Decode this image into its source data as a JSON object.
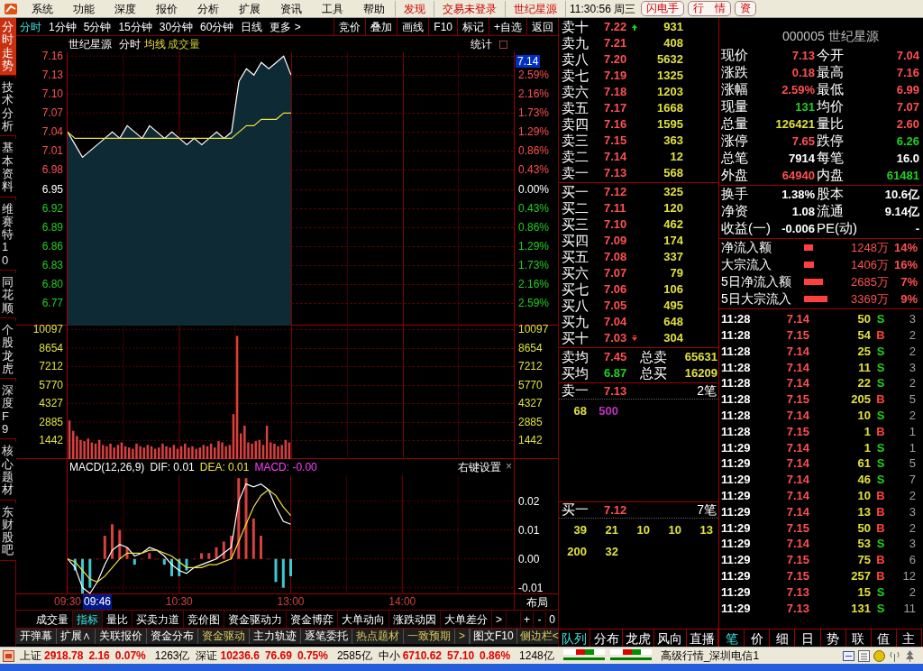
{
  "menu_bar": {
    "items": [
      "系统",
      "功能",
      "深度",
      "报价",
      "分析",
      "扩展",
      "资讯",
      "工具",
      "帮助"
    ],
    "links": [
      {
        "label": "发现"
      },
      {
        "label": "交易未登录"
      },
      {
        "label": "世纪星源"
      }
    ],
    "clock": "11:30:56 周三",
    "buttons": [
      "闪电手",
      "行　情",
      "资"
    ]
  },
  "side_tabs": [
    {
      "label": "分时走势",
      "selected": true
    },
    {
      "label": "技术分析",
      "selected": false
    },
    {
      "label": "基本资料",
      "selected": false
    },
    {
      "label": "维赛特10",
      "selected": false
    },
    {
      "label": "同花顺",
      "selected": false
    },
    {
      "label": "个股龙虎",
      "selected": false
    },
    {
      "label": "深度F9",
      "selected": false
    },
    {
      "label": "核心题材",
      "selected": false
    },
    {
      "label": "东财股吧",
      "selected": false
    }
  ],
  "period_tabs": [
    {
      "label": "分时",
      "selected": true
    },
    {
      "label": "1分钟",
      "selected": false
    },
    {
      "label": "5分钟",
      "selected": false
    },
    {
      "label": "15分钟",
      "selected": false
    },
    {
      "label": "30分钟",
      "selected": false
    },
    {
      "label": "60分钟",
      "selected": false
    },
    {
      "label": "日线",
      "selected": false
    },
    {
      "label": "更多 >",
      "selected": false
    }
  ],
  "chart_tools": [
    "竞价",
    "叠加",
    "画线",
    "F10",
    "标记",
    "+自选",
    "返回"
  ],
  "chart_header": {
    "name": "世纪星源",
    "mode": "分时",
    "stats": "统计"
  },
  "price_chart": {
    "current_price": "7.14",
    "pct_ticks": [
      "2.59%",
      "2.16%",
      "1.73%",
      "1.29%",
      "0.86%",
      "0.43%",
      "0.00%",
      "0.43%",
      "0.86%",
      "1.29%",
      "1.73%",
      "2.16%",
      "2.59%"
    ],
    "chart_data": {
      "type": "area",
      "grid": true,
      "ylim": [
        6.734,
        7.166
      ],
      "categories": [
        null,
        null,
        null,
        null,
        null,
        null,
        null,
        null,
        null,
        null,
        null,
        null,
        null,
        null,
        null,
        null,
        null,
        null,
        null,
        null,
        null,
        null,
        null,
        null,
        null,
        null,
        null,
        null,
        null,
        null,
        null
      ],
      "series": [
        {
          "color": "#ffffff",
          "values": [
            7.04,
            7.02,
            7.0,
            7.01,
            7.02,
            7.03,
            7.04,
            7.03,
            7.05,
            7.04,
            7.03,
            7.05,
            7.04,
            7.03,
            7.04,
            7.03,
            7.02,
            7.03,
            7.02,
            7.03,
            7.04,
            7.03,
            7.04,
            7.12,
            7.14,
            7.13,
            7.15,
            7.14,
            7.15,
            7.16,
            7.13
          ]
        },
        {
          "name": "均线",
          "type": "line",
          "color": "#f0e040",
          "values": [
            7.04,
            7.03,
            7.03,
            7.03,
            7.03,
            7.03,
            7.03,
            7.03,
            7.03,
            7.03,
            7.03,
            7.03,
            7.03,
            7.03,
            7.03,
            7.03,
            7.03,
            7.03,
            7.03,
            7.03,
            7.03,
            7.03,
            7.03,
            7.04,
            7.05,
            7.05,
            7.06,
            7.06,
            7.06,
            7.07,
            7.07
          ]
        }
      ],
      "yticks": [
        {
          "value": 7.16,
          "label": "7.16"
        },
        {
          "value": 7.13,
          "label": "7.13"
        },
        {
          "value": 7.1,
          "label": "7.10"
        },
        {
          "value": 7.07,
          "label": "7.07"
        },
        {
          "value": 7.04,
          "label": "7.04"
        },
        {
          "value": 7.01,
          "label": "7.01"
        },
        {
          "value": 6.98,
          "label": "6.98"
        },
        {
          "value": 6.95,
          "label": "6.95"
        },
        {
          "value": 6.92,
          "label": "6.92"
        },
        {
          "value": 6.89,
          "label": "6.89"
        },
        {
          "value": 6.86,
          "label": "6.86"
        },
        {
          "value": 6.83,
          "label": "6.83"
        },
        {
          "value": 6.8,
          "label": "6.80"
        },
        {
          "value": 6.77,
          "label": "6.77"
        }
      ]
    }
  },
  "volume_chart": {
    "chart_data": {
      "type": "bar",
      "grid": true,
      "ylim": [
        0,
        10400
      ],
      "categories": [
        null,
        null,
        null,
        null,
        null,
        null,
        null,
        null,
        null,
        null,
        null,
        null,
        null,
        null,
        null,
        null,
        null,
        null,
        null,
        null,
        null,
        null,
        null,
        null,
        null,
        null,
        null,
        null,
        null,
        null,
        null,
        null,
        null,
        null,
        null,
        null,
        null,
        null,
        null,
        null,
        null,
        null,
        null,
        null,
        null,
        null,
        null,
        null,
        null,
        null,
        null,
        null,
        null,
        null,
        null,
        null,
        null,
        null,
        null,
        null
      ],
      "series": [
        {
          "name": "成交量",
          "color": "#d84040",
          "values": [
            3000,
            2200,
            1800,
            1500,
            1400,
            1600,
            1300,
            1200,
            1500,
            1100,
            1000,
            1200,
            900,
            1100,
            1300,
            1000,
            900,
            800,
            1200,
            1000,
            900,
            1100,
            1000,
            800,
            900,
            1200,
            1000,
            900,
            1100,
            800,
            1000,
            1200,
            900,
            1000,
            800,
            900,
            1100,
            1000,
            1200,
            900,
            1400,
            1300,
            1000,
            1100,
            3500,
            9600,
            2000,
            2600,
            1300,
            1200,
            1400,
            1500,
            1100,
            2600,
            1300,
            1200,
            1000,
            1100,
            1500,
            1300
          ]
        }
      ],
      "yticks": [
        {
          "value": 10097,
          "label": "10097"
        },
        {
          "value": 8654,
          "label": "8654"
        },
        {
          "value": 7212,
          "label": "7212"
        },
        {
          "value": 5770,
          "label": "5770"
        },
        {
          "value": 4327,
          "label": "4327"
        },
        {
          "value": 2885,
          "label": "2885"
        },
        {
          "value": 1442,
          "label": "1442"
        }
      ]
    }
  },
  "macd_chart": {
    "legend": [
      {
        "text": "MACD(12,26,9)",
        "color": "#ffffff"
      },
      {
        "text": "DIF: 0.01",
        "color": "#ffffff"
      },
      {
        "text": "DEA: 0.01",
        "color": "#f0e040"
      },
      {
        "text": "MACD: -0.00",
        "color": "#ff40ff"
      }
    ],
    "settings": "右键设置",
    "close": "×",
    "chart_data": {
      "type": "line",
      "grid": true,
      "ylim": [
        -0.0123,
        0.029
      ],
      "categories": [
        "09:30",
        null,
        null,
        null,
        null,
        null,
        null,
        null,
        null,
        null,
        null,
        null,
        null,
        null,
        null,
        "10:30",
        null,
        null,
        null,
        null,
        null,
        null,
        null,
        null,
        null,
        null,
        null,
        null,
        null,
        null,
        "13:00",
        null,
        null,
        null,
        null,
        null,
        null,
        null,
        null,
        null,
        null,
        null,
        null,
        null,
        null,
        "14:00",
        null,
        null,
        null,
        null,
        null,
        null,
        null,
        null,
        null,
        null,
        null,
        null,
        null,
        null,
        null
      ],
      "series": [
        {
          "type": "bar",
          "color": "#d84040",
          "values": [
            0,
            null,
            null,
            null,
            0,
            0.008,
            0.012,
            0.01,
            0.004,
            null,
            0,
            0.002,
            0,
            null,
            null,
            null,
            null,
            0,
            0.002,
            0.002,
            0.004,
            0.006,
            0.008,
            0.028,
            0.028,
            0.014,
            0.008,
            0,
            null,
            null,
            null,
            null,
            null,
            null,
            null,
            null,
            null,
            null,
            null,
            null,
            null,
            null,
            null,
            null,
            null,
            null,
            null,
            null,
            null,
            null,
            null,
            null,
            null,
            null,
            null,
            null,
            null,
            null,
            null,
            null,
            null
          ]
        },
        {
          "type": "bar",
          "color": "#40c8d0",
          "values": [
            null,
            -0.004,
            -0.012,
            -0.01,
            null,
            null,
            null,
            null,
            null,
            -0.002,
            null,
            null,
            null,
            -0.002,
            -0.006,
            -0.006,
            -0.004,
            null,
            null,
            null,
            null,
            null,
            null,
            null,
            null,
            null,
            null,
            null,
            -0.008,
            -0.01,
            -0.006,
            null,
            null,
            null,
            null,
            null,
            null,
            null,
            null,
            null,
            null,
            null,
            null,
            null,
            null,
            null,
            null,
            null,
            null,
            null,
            null,
            null,
            null,
            null,
            null,
            null,
            null,
            null,
            null,
            null,
            null
          ]
        },
        {
          "type": "line",
          "color": "#ffffff",
          "values": [
            0,
            -0.003,
            -0.01,
            -0.012,
            -0.008,
            -0.002,
            0.003,
            0.005,
            0.004,
            0.001,
            0.002,
            0.004,
            0.003,
            0.001,
            -0.002,
            -0.004,
            -0.005,
            -0.003,
            -0.002,
            -0.001,
            0,
            0.002,
            0.004,
            0.02,
            0.026,
            0.025,
            0.026,
            0.024,
            0.018,
            0.013,
            0.012,
            null,
            null,
            null,
            null,
            null,
            null,
            null,
            null,
            null,
            null,
            null,
            null,
            null,
            null,
            null,
            null,
            null,
            null,
            null,
            null,
            null,
            null,
            null,
            null,
            null,
            null,
            null,
            null,
            null,
            null
          ]
        },
        {
          "type": "line",
          "color": "#f0e040",
          "values": [
            0,
            -0.001,
            -0.004,
            -0.007,
            -0.008,
            -0.006,
            -0.003,
            0,
            0.002,
            0.002,
            0.002,
            0.003,
            0.003,
            0.002,
            0.001,
            -0.001,
            -0.003,
            -0.003,
            -0.003,
            -0.002,
            -0.002,
            -0.001,
            0,
            0.006,
            0.012,
            0.018,
            0.022,
            0.024,
            0.022,
            0.018,
            0.015,
            null,
            null,
            null,
            null,
            null,
            null,
            null,
            null,
            null,
            null,
            null,
            null,
            null,
            null,
            null,
            null,
            null,
            null,
            null,
            null,
            null,
            null,
            null,
            null,
            null,
            null,
            null,
            null,
            null,
            null
          ]
        }
      ],
      "yticks": [
        {
          "value": 0.02,
          "label": "0.02"
        },
        {
          "value": 0.01,
          "label": "0.01"
        },
        {
          "value": 0,
          "label": "0.00"
        },
        {
          "value": -0.01,
          "label": "-0.01"
        }
      ]
    }
  },
  "time_axis": {
    "cursor": "09:46",
    "layout_button": "布局"
  },
  "indicator_tabs": [
    {
      "label": "成交量",
      "selected": false
    },
    {
      "label": "指标",
      "selected": true
    },
    {
      "label": "量比",
      "selected": false
    },
    {
      "label": "买卖力道",
      "selected": false
    },
    {
      "label": "竞价图",
      "selected": false
    },
    {
      "label": "资金驱动力",
      "selected": false
    },
    {
      "label": "资金博弈",
      "selected": false
    },
    {
      "label": "大单动向",
      "selected": false
    },
    {
      "label": "涨跌动因",
      "selected": false
    },
    {
      "label": "大单差分",
      "selected": false
    },
    {
      "label": ">",
      "selected": false
    }
  ],
  "zoom_buttons": [
    "+",
    "-",
    "0"
  ],
  "feature_tabs": [
    {
      "label": "开弹幕",
      "highlighted": false
    },
    {
      "label": "扩展∧",
      "highlighted": false
    },
    {
      "label": "关联报价",
      "highlighted": false
    },
    {
      "label": "资金分布",
      "highlighted": false
    },
    {
      "label": "资金驱动",
      "highlighted": true
    },
    {
      "label": "主力轨迹",
      "highlighted": false
    },
    {
      "label": "逐笔委托",
      "highlighted": false
    },
    {
      "label": "热点题材",
      "highlighted": true
    },
    {
      "label": "一致预期",
      "highlighted": true
    },
    {
      "label": ">",
      "highlighted": true
    }
  ],
  "feature_right": [
    {
      "label": "图文F10",
      "highlighted": false
    },
    {
      "label": "侧边栏<",
      "highlighted": true
    }
  ],
  "order_book": {
    "asks": [
      {
        "label": "卖十",
        "price": "7.22",
        "volume": "931",
        "marker": true
      },
      {
        "label": "卖九",
        "price": "7.21",
        "volume": "408",
        "marker": false
      },
      {
        "label": "卖八",
        "price": "7.20",
        "volume": "5632",
        "marker": false
      },
      {
        "label": "卖七",
        "price": "7.19",
        "volume": "1325",
        "marker": false
      },
      {
        "label": "卖六",
        "price": "7.18",
        "volume": "1203",
        "marker": false
      },
      {
        "label": "卖五",
        "price": "7.17",
        "volume": "1668",
        "marker": false
      },
      {
        "label": "卖四",
        "price": "7.16",
        "volume": "1595",
        "marker": false
      },
      {
        "label": "卖三",
        "price": "7.15",
        "volume": "363",
        "marker": false
      },
      {
        "label": "卖二",
        "price": "7.14",
        "volume": "12",
        "marker": false
      },
      {
        "label": "卖一",
        "price": "7.13",
        "volume": "568",
        "marker": false
      }
    ],
    "bids": [
      {
        "label": "买一",
        "price": "7.12",
        "volume": "325",
        "marker": false
      },
      {
        "label": "买二",
        "price": "7.11",
        "volume": "120",
        "marker": false
      },
      {
        "label": "买三",
        "price": "7.10",
        "volume": "462",
        "marker": false
      },
      {
        "label": "买四",
        "price": "7.09",
        "volume": "174",
        "marker": false
      },
      {
        "label": "买五",
        "price": "7.08",
        "volume": "337",
        "marker": false
      },
      {
        "label": "买六",
        "price": "7.07",
        "volume": "79",
        "marker": false
      },
      {
        "label": "买七",
        "price": "7.06",
        "volume": "106",
        "marker": false
      },
      {
        "label": "买八",
        "price": "7.05",
        "volume": "495",
        "marker": false
      },
      {
        "label": "买九",
        "price": "7.04",
        "volume": "648",
        "marker": false
      },
      {
        "label": "买十",
        "price": "7.03",
        "volume": "304",
        "marker": true
      }
    ],
    "averages": [
      {
        "label": "卖均",
        "price": "7.45",
        "color": "#ff5050",
        "total_label": "总卖",
        "total": "65631"
      },
      {
        "label": "买均",
        "price": "6.87",
        "color": "#20d020",
        "total_label": "总买",
        "total": "16209"
      }
    ],
    "queues": [
      {
        "label": "卖一",
        "price": "7.13",
        "count": "2笔",
        "orders": [
          {
            "text": "68",
            "color": "#e0e040"
          },
          {
            "text": "500",
            "color": "#c030c0"
          }
        ]
      },
      {
        "label": "买一",
        "price": "7.12",
        "count": "7笔",
        "orders": [
          {
            "text": "39",
            "color": "#e0e040"
          },
          {
            "text": "21",
            "color": "#e0e040"
          },
          {
            "text": "10",
            "color": "#e0e040"
          },
          {
            "text": "10",
            "color": "#e0e040"
          },
          {
            "text": "13",
            "color": "#e0e040"
          },
          {
            "text": "200",
            "color": "#e0e040"
          },
          {
            "text": "32",
            "color": "#e0e040"
          }
        ]
      }
    ],
    "tabs": [
      {
        "label": "队列",
        "selected": true
      },
      {
        "label": "分布",
        "selected": false
      },
      {
        "label": "龙虎",
        "selected": false
      },
      {
        "label": "风向",
        "selected": false
      },
      {
        "label": "直播",
        "selected": false
      }
    ]
  },
  "quote": {
    "title": "000005 世纪星源",
    "rows": [
      [
        {
          "label": "现价",
          "value": "7.13",
          "color": "#ff5050"
        },
        {
          "label": "今开",
          "value": "7.04",
          "color": "#ff5050"
        }
      ],
      [
        {
          "label": "涨跌",
          "value": "0.18",
          "color": "#ff5050"
        },
        {
          "label": "最高",
          "value": "7.16",
          "color": "#ff5050"
        }
      ],
      [
        {
          "label": "涨幅",
          "value": "2.59%",
          "color": "#ff5050"
        },
        {
          "label": "最低",
          "value": "6.99",
          "color": "#ff5050"
        }
      ],
      [
        {
          "label": "现量",
          "value": "131",
          "color": "#20d020"
        },
        {
          "label": "均价",
          "value": "7.07",
          "color": "#ff5050"
        }
      ],
      [
        {
          "label": "总量",
          "value": "126421",
          "color": "#e0e040"
        },
        {
          "label": "量比",
          "value": "2.60",
          "color": "#ff5050"
        }
      ],
      [
        {
          "label": "涨停",
          "value": "7.65",
          "color": "#ff5050"
        },
        {
          "label": "跌停",
          "value": "6.26",
          "color": "#20d020"
        }
      ],
      [
        {
          "label": "总笔",
          "value": "7914",
          "color": "#ffffff"
        },
        {
          "label": "每笔",
          "value": "16.0",
          "color": "#ffffff"
        }
      ],
      [
        {
          "label": "外盘",
          "value": "64940",
          "color": "#ff5050"
        },
        {
          "label": "内盘",
          "value": "61481",
          "color": "#20d020"
        }
      ]
    ],
    "fundamentals": [
      [
        {
          "label": "换手",
          "value": "1.38%"
        },
        {
          "label": "股本",
          "value": "10.6亿"
        }
      ],
      [
        {
          "label": "净资",
          "value": "1.08"
        },
        {
          "label": "流通",
          "value": "9.14亿"
        }
      ],
      [
        {
          "label": "收益(一)",
          "value": "-0.006"
        },
        {
          "label": "PE(动)",
          "value": "-"
        }
      ]
    ],
    "flows": [
      {
        "label": "净流入额",
        "amount": "1248万",
        "pct": "14%"
      },
      {
        "label": "大宗流入",
        "amount": "1406万",
        "pct": "16%"
      },
      {
        "label": "5日净流入额",
        "amount": "2685万",
        "pct": "7%"
      },
      {
        "label": "5日大宗流入",
        "amount": "3369万",
        "pct": "9%"
      }
    ]
  },
  "trades": [
    {
      "time": "11:28",
      "price": "7.14",
      "volume": "50",
      "side": "S",
      "color": "#20d020",
      "count": "3"
    },
    {
      "time": "11:28",
      "price": "7.15",
      "volume": "54",
      "side": "B",
      "color": "#ff4040",
      "count": "2"
    },
    {
      "time": "11:28",
      "price": "7.14",
      "volume": "25",
      "side": "S",
      "color": "#20d020",
      "count": "2"
    },
    {
      "time": "11:28",
      "price": "7.14",
      "volume": "11",
      "side": "S",
      "color": "#20d020",
      "count": "3"
    },
    {
      "time": "11:28",
      "price": "7.14",
      "volume": "22",
      "side": "S",
      "color": "#20d020",
      "count": "2"
    },
    {
      "time": "11:28",
      "price": "7.15",
      "volume": "205",
      "side": "B",
      "color": "#ff4040",
      "count": "5"
    },
    {
      "time": "11:28",
      "price": "7.14",
      "volume": "10",
      "side": "S",
      "color": "#20d020",
      "count": "2"
    },
    {
      "time": "11:28",
      "price": "7.15",
      "volume": "1",
      "side": "B",
      "color": "#ff4040",
      "count": "1"
    },
    {
      "time": "11:29",
      "price": "7.14",
      "volume": "1",
      "side": "S",
      "color": "#20d020",
      "count": "1"
    },
    {
      "time": "11:29",
      "price": "7.14",
      "volume": "61",
      "side": "S",
      "color": "#20d020",
      "count": "5"
    },
    {
      "time": "11:29",
      "price": "7.14",
      "volume": "46",
      "side": "S",
      "color": "#20d020",
      "count": "7"
    },
    {
      "time": "11:29",
      "price": "7.14",
      "volume": "10",
      "side": "B",
      "color": "#ff4040",
      "count": "2"
    },
    {
      "time": "11:29",
      "price": "7.14",
      "volume": "13",
      "side": "B",
      "color": "#ff4040",
      "count": "3"
    },
    {
      "time": "11:29",
      "price": "7.15",
      "volume": "50",
      "side": "B",
      "color": "#ff4040",
      "count": "2"
    },
    {
      "time": "11:29",
      "price": "7.14",
      "volume": "53",
      "side": "S",
      "color": "#20d020",
      "count": "3"
    },
    {
      "time": "11:29",
      "price": "7.15",
      "volume": "75",
      "side": "B",
      "color": "#ff4040",
      "count": "6"
    },
    {
      "time": "11:29",
      "price": "7.15",
      "volume": "257",
      "side": "B",
      "color": "#ff4040",
      "count": "12"
    },
    {
      "time": "11:29",
      "price": "7.13",
      "volume": "15",
      "side": "S",
      "color": "#20d020",
      "count": "2"
    },
    {
      "time": "11:29",
      "price": "7.13",
      "volume": "131",
      "side": "S",
      "color": "#20d020",
      "count": "11"
    }
  ],
  "trade_tabs": [
    {
      "label": "笔",
      "selected": true
    },
    {
      "label": "价",
      "selected": false
    },
    {
      "label": "细",
      "selected": false
    },
    {
      "label": "日",
      "selected": false
    },
    {
      "label": "势",
      "selected": false
    },
    {
      "label": "联",
      "selected": false
    },
    {
      "label": "值",
      "selected": false
    },
    {
      "label": "主",
      "selected": false
    }
  ],
  "status_bar": {
    "indices": [
      {
        "text": "上证",
        "kind": "label"
      },
      {
        "text": "2918.78",
        "kind": "value"
      },
      {
        "text": "2.16",
        "kind": "value"
      },
      {
        "text": "0.07%",
        "kind": "value"
      },
      {
        "text": "1263亿",
        "kind": "amount"
      },
      {
        "text": "深证",
        "kind": "label"
      },
      {
        "text": "10236.6",
        "kind": "value"
      },
      {
        "text": "76.69",
        "kind": "value"
      },
      {
        "text": "0.75%",
        "kind": "value"
      },
      {
        "text": "2585亿",
        "kind": "amount"
      },
      {
        "text": "中小",
        "kind": "label"
      },
      {
        "text": "6710.62",
        "kind": "value"
      },
      {
        "text": "57.10",
        "kind": "value"
      },
      {
        "text": "0.86%",
        "kind": "value"
      },
      {
        "text": "1248亿",
        "kind": "amount"
      }
    ],
    "server": "高级行情_深圳电信1"
  }
}
